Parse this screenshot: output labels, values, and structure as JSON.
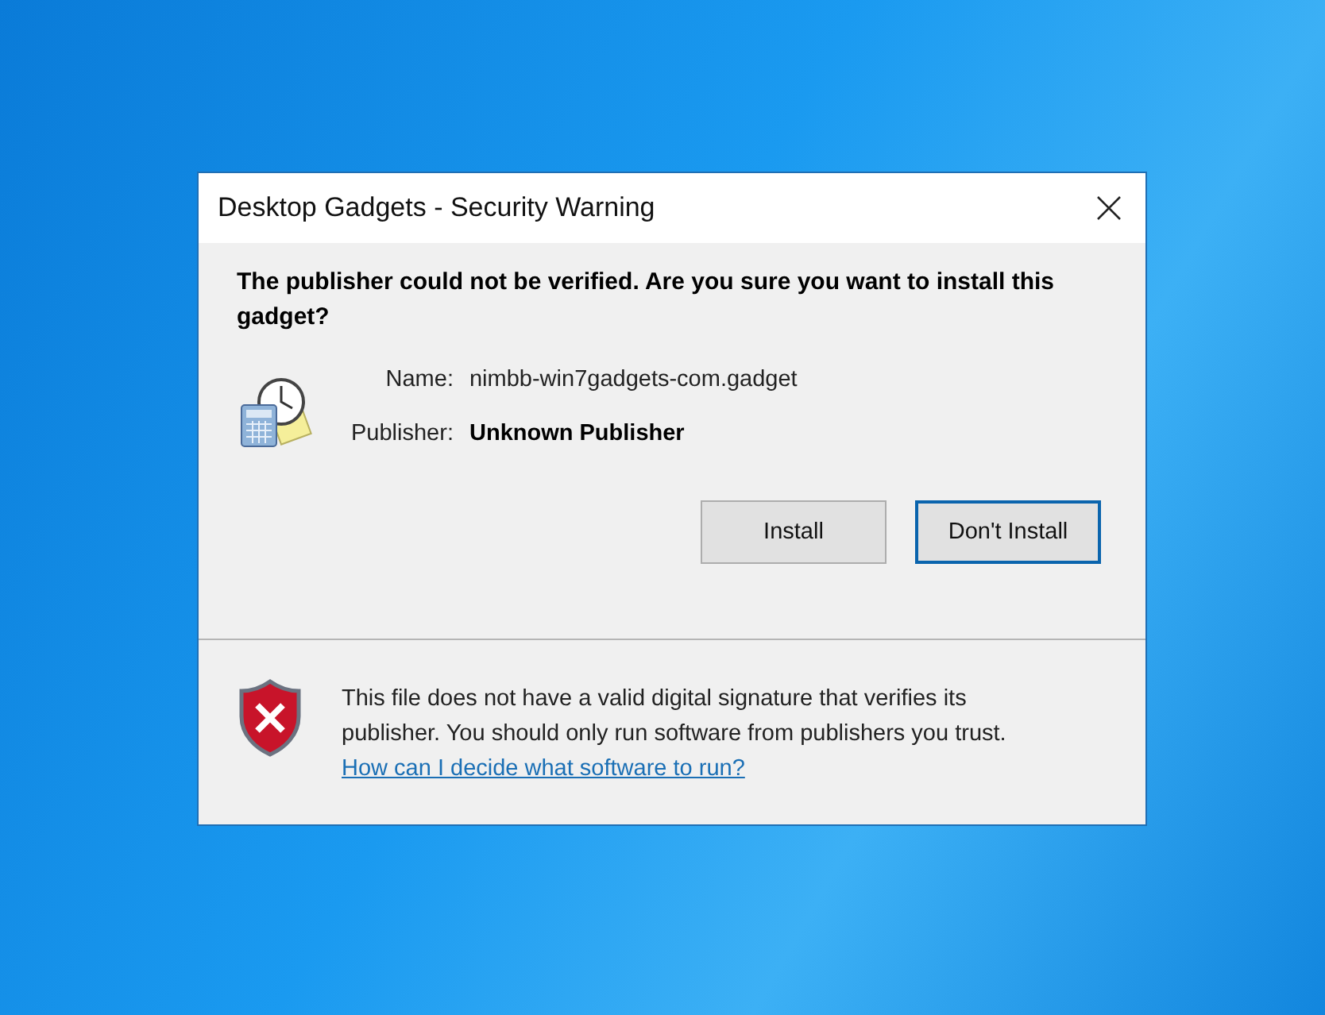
{
  "window": {
    "title": "Desktop Gadgets - Security Warning"
  },
  "heading": "The publisher could not be verified. Are you sure you want to install this gadget?",
  "details": [
    {
      "label": "Name:",
      "value": "nimbb-win7gadgets-com.gadget",
      "bold": false
    },
    {
      "label": "Publisher:",
      "value": "Unknown Publisher",
      "bold": true
    }
  ],
  "buttons": [
    {
      "label": "Install",
      "focused": false
    },
    {
      "label": "Don't Install",
      "focused": true
    }
  ],
  "footer": {
    "message": "This file does not have a valid digital signature that verifies its publisher. You should only run software from publishers you trust.",
    "link": "How can I decide what software to run?"
  }
}
